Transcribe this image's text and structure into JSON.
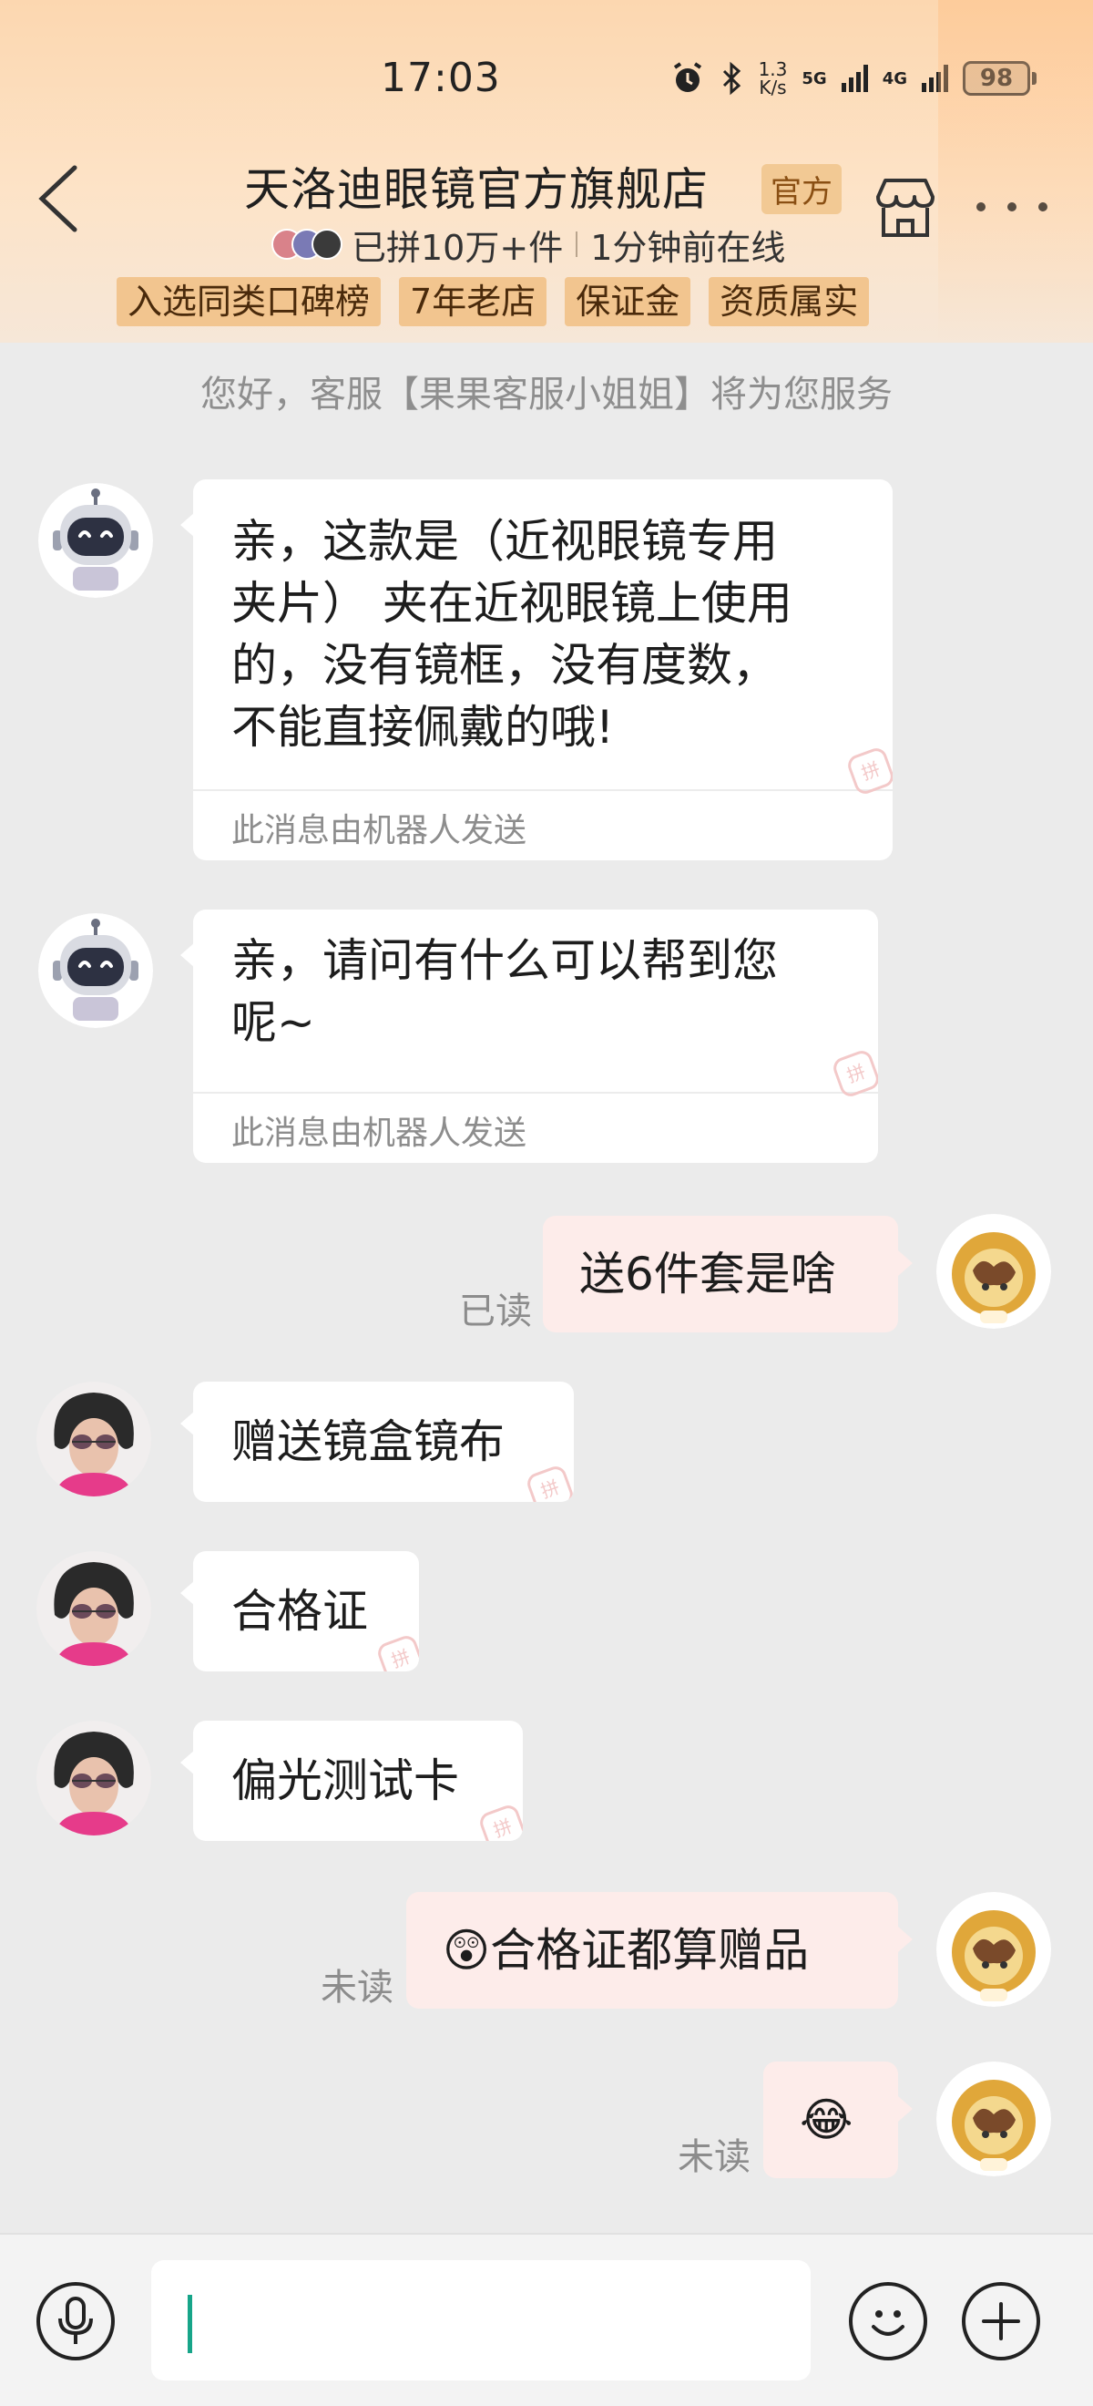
{
  "status_bar": {
    "time": "17:03",
    "speed_value": "1.3",
    "speed_unit": "K/s",
    "net_5g": "5G",
    "net_4g": "4G",
    "battery": "98"
  },
  "header": {
    "shop_name": "天洛迪眼镜官方旗舰店",
    "official_tag": "官方",
    "sold_text": "已拼10万+件",
    "online_text": "1分钟前在线",
    "badges": [
      "入选同类口碑榜",
      "7年老店",
      "保证金",
      "资质属实"
    ]
  },
  "service_note": "您好，客服【果果客服小姐姐】将为您服务",
  "messages": [
    {
      "side": "left",
      "sender": "bot",
      "lines": [
        "亲，这款是（近视眼镜专用",
        "夹片） 夹在近视眼镜上使用",
        "的，没有镜框，没有度数，",
        "不能直接佩戴的哦!"
      ],
      "footer": "此消息由机器人发送"
    },
    {
      "side": "left",
      "sender": "bot",
      "lines": [
        "亲，请问有什么可以帮到您",
        "呢~"
      ],
      "footer": "此消息由机器人发送"
    },
    {
      "side": "right",
      "sender": "me",
      "text": "送6件套是啥",
      "status": "已读"
    },
    {
      "side": "left",
      "sender": "agent",
      "text": "赠送镜盒镜布"
    },
    {
      "side": "left",
      "sender": "agent",
      "text": "合格证"
    },
    {
      "side": "left",
      "sender": "agent",
      "text": "偏光测试卡"
    },
    {
      "side": "right",
      "sender": "me",
      "emoji": "😲",
      "text": "合格证都算赠品",
      "status": "未读"
    },
    {
      "side": "right",
      "sender": "me",
      "emoji": "😂",
      "text": "",
      "status": "未读"
    }
  ],
  "watermark_char": "拼",
  "icons": {
    "back": "chevron-left-icon",
    "store": "store-icon",
    "more": "more-dots-icon",
    "mic": "microphone-icon",
    "emoji": "smiley-icon",
    "plus": "plus-icon"
  },
  "colors": {
    "header_top": "#fcd7b0",
    "badge_bg": "#f2c58f",
    "chat_bg": "#ebebeb",
    "my_bubble": "#fdecea",
    "caret": "#17a589"
  }
}
